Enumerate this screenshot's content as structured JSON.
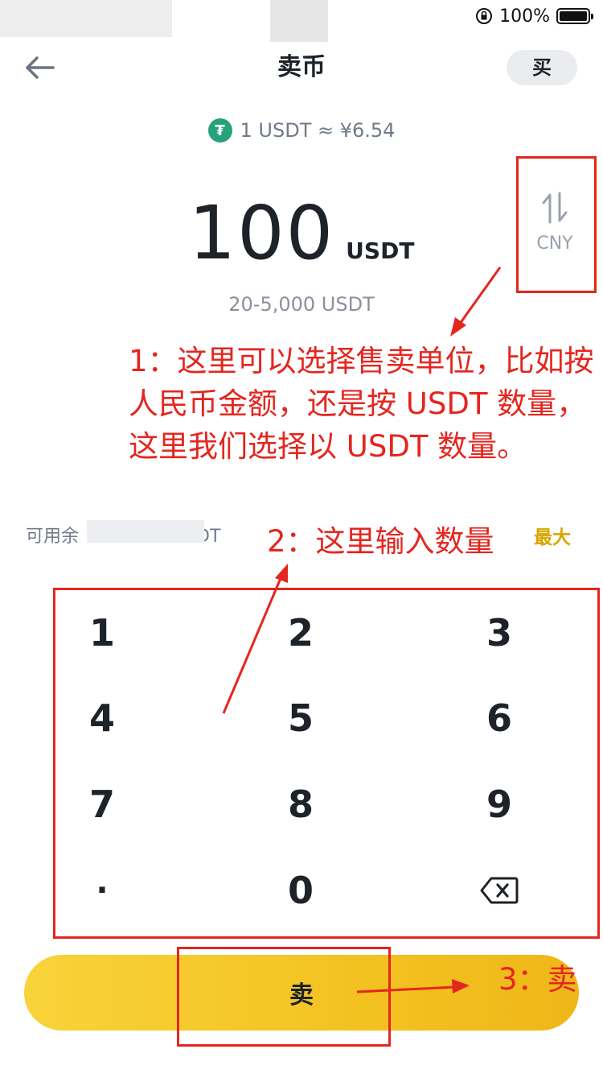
{
  "status_bar": {
    "battery": "100%",
    "battery_level": 1.0
  },
  "header": {
    "title": "卖币",
    "buy_label": "买"
  },
  "rate": {
    "text": "1 USDT ≈ ¥6.54",
    "coin_icon": "tether-icon"
  },
  "amount": {
    "value": "100",
    "unit": "USDT"
  },
  "switch": {
    "label": "CNY"
  },
  "range": "20-5,000 USDT",
  "available": {
    "left_label": "可用余",
    "right_label": "DT"
  },
  "max_label": "最大",
  "keypad": [
    "1",
    "2",
    "3",
    "4",
    "5",
    "6",
    "7",
    "8",
    "9",
    "·",
    "0"
  ],
  "sell_label": "卖",
  "annotations": {
    "note1": "1：这里可以选择售卖单位，比如按人民币金额，还是按 USDT 数量，这里我们选择以 USDT 数量。",
    "note2": "2：这里输入数量",
    "note3": "3：卖"
  },
  "colors": {
    "accent": "#f0b90b",
    "annotation_red": "#e4261f",
    "text_primary": "#1e2329",
    "text_secondary": "#707a8a"
  }
}
